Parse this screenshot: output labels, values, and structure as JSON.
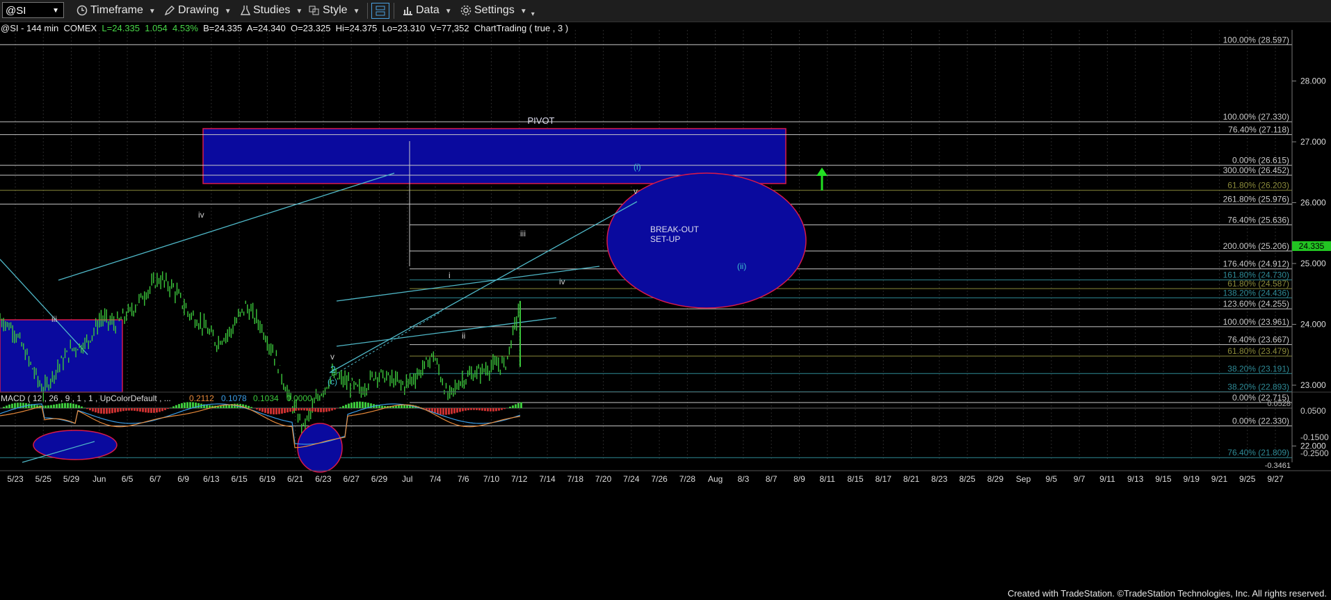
{
  "toolbar": {
    "symbol": "@SI",
    "timeframe": "Timeframe",
    "drawing": "Drawing",
    "studies": "Studies",
    "style": "Style",
    "data": "Data",
    "settings": "Settings"
  },
  "infobar": {
    "symbol": "@SI - 144 min",
    "exchange": "COMEX",
    "last": "L=24.335",
    "change": "1.054",
    "change_pct": "4.53%",
    "bid": "B=24.335",
    "ask": "A=24.340",
    "open": "O=23.325",
    "high": "Hi=24.375",
    "low": "Lo=23.310",
    "volume": "V=77,352",
    "chart_trading": "ChartTrading ( true , 3 )"
  },
  "chart_data": {
    "type": "line",
    "price_axis": {
      "ylim": [
        21.6,
        28.75
      ],
      "ticks": [
        "28.000",
        "27.000",
        "26.000",
        "25.000",
        "24.000",
        "23.000",
        "22.000"
      ],
      "current_price": "24.335"
    },
    "x_ticks": [
      "5/23",
      "5/25",
      "5/29",
      "Jun",
      "6/5",
      "6/7",
      "6/9",
      "6/13",
      "6/15",
      "6/19",
      "6/21",
      "6/23",
      "6/27",
      "6/29",
      "Jul",
      "7/4",
      "7/6",
      "7/10",
      "7/12",
      "7/14",
      "7/18",
      "7/20",
      "7/24",
      "7/26",
      "7/28",
      "Aug",
      "8/3",
      "8/7",
      "8/9",
      "8/11",
      "8/15",
      "8/17",
      "8/21",
      "8/23",
      "8/25",
      "8/29",
      "Sep",
      "9/5",
      "9/7",
      "9/11",
      "9/13",
      "9/15",
      "9/19",
      "9/21",
      "9/25",
      "9/27"
    ],
    "price_path": [
      [
        "5/23",
        24.1
      ],
      [
        "5/24",
        23.9
      ],
      [
        "5/25",
        23.4
      ],
      [
        "5/26",
        22.9
      ],
      [
        "5/29",
        23.3
      ],
      [
        "5/31",
        23.6
      ],
      [
        "Jun",
        23.7
      ],
      [
        "6/2",
        24.1
      ],
      [
        "6/5",
        24.0
      ],
      [
        "6/7",
        24.2
      ],
      [
        "6/8",
        24.5
      ],
      [
        "6/9",
        24.75
      ],
      [
        "6/10",
        24.6
      ],
      [
        "6/13",
        24.2
      ],
      [
        "6/14",
        24.0
      ],
      [
        "6/15",
        23.7
      ],
      [
        "6/16",
        23.9
      ],
      [
        "6/19",
        24.3
      ],
      [
        "6/20",
        24.0
      ],
      [
        "6/21",
        23.5
      ],
      [
        "6/22",
        22.8
      ],
      [
        "6/23",
        22.3
      ],
      [
        "6/26",
        22.8
      ],
      [
        "6/27",
        23.15
      ],
      [
        "6/28",
        23.05
      ],
      [
        "6/29",
        22.9
      ],
      [
        "6/30",
        23.2
      ],
      [
        "7/3",
        23.1
      ],
      [
        "7/4",
        23.0
      ],
      [
        "7/5",
        23.2
      ],
      [
        "7/6",
        23.5
      ],
      [
        "7/7",
        22.8
      ],
      [
        "7/10",
        23.1
      ],
      [
        "7/11",
        23.2
      ],
      [
        "7/12",
        23.3
      ],
      [
        "7/13",
        23.35
      ],
      [
        "7/13b",
        24.335
      ]
    ],
    "fib_levels": [
      {
        "label": "100.00% (28.597)",
        "value": 28.597
      },
      {
        "label": "100.00% (27.330)",
        "value": 27.33
      },
      {
        "label": "76.40% (27.118)",
        "value": 27.118
      },
      {
        "label": "0.00% (26.615)",
        "value": 26.615
      },
      {
        "label": "300.00% (26.452)",
        "value": 26.452
      },
      {
        "label": "61.80% (26.203)",
        "value": 26.203
      },
      {
        "label": "261.80% (25.976)",
        "value": 25.976
      },
      {
        "label": "76.40% (25.636)",
        "value": 25.636
      },
      {
        "label": "200.00% (25.206)",
        "value": 25.206
      },
      {
        "label": "176.40% (24.912)",
        "value": 24.912
      },
      {
        "label": "161.80% (24.730)",
        "value": 24.73
      },
      {
        "label": "61.80% (24.587)",
        "value": 24.587
      },
      {
        "label": "138.20% (24.436)",
        "value": 24.436
      },
      {
        "label": "123.60% (24.255)",
        "value": 24.255
      },
      {
        "label": "100.00% (23.961)",
        "value": 23.961
      },
      {
        "label": "76.40% (23.667)",
        "value": 23.667
      },
      {
        "label": "61.80% (23.479)",
        "value": 23.479
      },
      {
        "label": "38.20% (23.191)",
        "value": 23.191
      },
      {
        "label": "38.20% (22.893)",
        "value": 22.893
      },
      {
        "label": "0.00% (22.715)",
        "value": 22.715
      },
      {
        "label": "0.00% (22.330)",
        "value": 22.33
      },
      {
        "label": "76.40% (21.809)",
        "value": 21.809
      }
    ],
    "annotations": {
      "pivot": "PIVOT",
      "breakout_line1": "BREAK-OUT",
      "breakout_line2": "SET-UP",
      "wave_labels": [
        "iv",
        "iii",
        "i",
        "ii",
        "iii",
        "iv",
        "v",
        "v",
        "2",
        "(c)",
        "(i)",
        "(ii)"
      ]
    },
    "macd": {
      "title": "MACD ( 12 , 26 , 9 , 1 , 1 , UpColorDefault , ...",
      "values": [
        "0.2112",
        "0.1078",
        "0.1034",
        "0.0000"
      ],
      "ticks": [
        "0.0528",
        "0.0500",
        "-0.1500",
        "-0.2500",
        "-0.3461"
      ]
    }
  },
  "footer": {
    "credit": "Created with TradeStation. ©TradeStation Technologies, Inc. All rights reserved."
  },
  "colors": {
    "candle": "#3cc83c",
    "trendline": "#4fb8c8",
    "box_fill": "#0a0a9e",
    "box_border": "#d81a4a",
    "fib_white": "#c8c8c8",
    "fib_olive": "#8a8a3a",
    "fib_teal": "#2e8a96",
    "arrow": "#22e022"
  }
}
